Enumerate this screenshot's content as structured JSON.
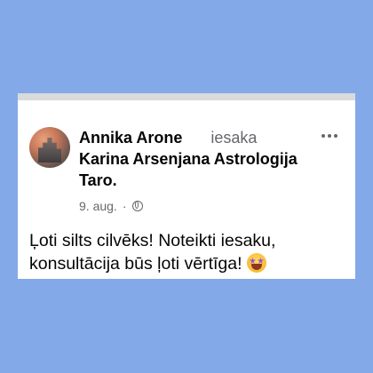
{
  "post": {
    "author_name": "Annika Arone",
    "action": "iesaka",
    "target_page": "Karina Arsenjana Astrologija Taro",
    "target_suffix": ".",
    "date": "9. aug.",
    "separator": "·",
    "privacy_icon": "globe-icon",
    "more_icon": "ellipsis-icon",
    "text": "Ļoti silts cilvēks! Noteikti iesaku, konsultācija būs ļoti vērtīga!",
    "emoji": "star-struck-emoji"
  },
  "colors": {
    "background": "#84a9e8",
    "card": "#ffffff",
    "card_top_border": "#d9dadc",
    "primary_text": "#050505",
    "secondary_text": "#65676b"
  }
}
